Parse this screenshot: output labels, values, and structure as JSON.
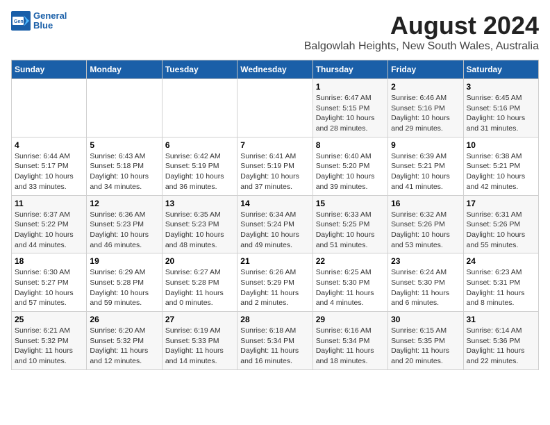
{
  "header": {
    "logo_line1": "General",
    "logo_line2": "Blue",
    "main_title": "August 2024",
    "subtitle": "Balgowlah Heights, New South Wales, Australia"
  },
  "weekdays": [
    "Sunday",
    "Monday",
    "Tuesday",
    "Wednesday",
    "Thursday",
    "Friday",
    "Saturday"
  ],
  "weeks": [
    [
      {
        "day": "",
        "info": ""
      },
      {
        "day": "",
        "info": ""
      },
      {
        "day": "",
        "info": ""
      },
      {
        "day": "",
        "info": ""
      },
      {
        "day": "1",
        "info": "Sunrise: 6:47 AM\nSunset: 5:15 PM\nDaylight: 10 hours\nand 28 minutes."
      },
      {
        "day": "2",
        "info": "Sunrise: 6:46 AM\nSunset: 5:16 PM\nDaylight: 10 hours\nand 29 minutes."
      },
      {
        "day": "3",
        "info": "Sunrise: 6:45 AM\nSunset: 5:16 PM\nDaylight: 10 hours\nand 31 minutes."
      }
    ],
    [
      {
        "day": "4",
        "info": "Sunrise: 6:44 AM\nSunset: 5:17 PM\nDaylight: 10 hours\nand 33 minutes."
      },
      {
        "day": "5",
        "info": "Sunrise: 6:43 AM\nSunset: 5:18 PM\nDaylight: 10 hours\nand 34 minutes."
      },
      {
        "day": "6",
        "info": "Sunrise: 6:42 AM\nSunset: 5:19 PM\nDaylight: 10 hours\nand 36 minutes."
      },
      {
        "day": "7",
        "info": "Sunrise: 6:41 AM\nSunset: 5:19 PM\nDaylight: 10 hours\nand 37 minutes."
      },
      {
        "day": "8",
        "info": "Sunrise: 6:40 AM\nSunset: 5:20 PM\nDaylight: 10 hours\nand 39 minutes."
      },
      {
        "day": "9",
        "info": "Sunrise: 6:39 AM\nSunset: 5:21 PM\nDaylight: 10 hours\nand 41 minutes."
      },
      {
        "day": "10",
        "info": "Sunrise: 6:38 AM\nSunset: 5:21 PM\nDaylight: 10 hours\nand 42 minutes."
      }
    ],
    [
      {
        "day": "11",
        "info": "Sunrise: 6:37 AM\nSunset: 5:22 PM\nDaylight: 10 hours\nand 44 minutes."
      },
      {
        "day": "12",
        "info": "Sunrise: 6:36 AM\nSunset: 5:23 PM\nDaylight: 10 hours\nand 46 minutes."
      },
      {
        "day": "13",
        "info": "Sunrise: 6:35 AM\nSunset: 5:23 PM\nDaylight: 10 hours\nand 48 minutes."
      },
      {
        "day": "14",
        "info": "Sunrise: 6:34 AM\nSunset: 5:24 PM\nDaylight: 10 hours\nand 49 minutes."
      },
      {
        "day": "15",
        "info": "Sunrise: 6:33 AM\nSunset: 5:25 PM\nDaylight: 10 hours\nand 51 minutes."
      },
      {
        "day": "16",
        "info": "Sunrise: 6:32 AM\nSunset: 5:26 PM\nDaylight: 10 hours\nand 53 minutes."
      },
      {
        "day": "17",
        "info": "Sunrise: 6:31 AM\nSunset: 5:26 PM\nDaylight: 10 hours\nand 55 minutes."
      }
    ],
    [
      {
        "day": "18",
        "info": "Sunrise: 6:30 AM\nSunset: 5:27 PM\nDaylight: 10 hours\nand 57 minutes."
      },
      {
        "day": "19",
        "info": "Sunrise: 6:29 AM\nSunset: 5:28 PM\nDaylight: 10 hours\nand 59 minutes."
      },
      {
        "day": "20",
        "info": "Sunrise: 6:27 AM\nSunset: 5:28 PM\nDaylight: 11 hours\nand 0 minutes."
      },
      {
        "day": "21",
        "info": "Sunrise: 6:26 AM\nSunset: 5:29 PM\nDaylight: 11 hours\nand 2 minutes."
      },
      {
        "day": "22",
        "info": "Sunrise: 6:25 AM\nSunset: 5:30 PM\nDaylight: 11 hours\nand 4 minutes."
      },
      {
        "day": "23",
        "info": "Sunrise: 6:24 AM\nSunset: 5:30 PM\nDaylight: 11 hours\nand 6 minutes."
      },
      {
        "day": "24",
        "info": "Sunrise: 6:23 AM\nSunset: 5:31 PM\nDaylight: 11 hours\nand 8 minutes."
      }
    ],
    [
      {
        "day": "25",
        "info": "Sunrise: 6:21 AM\nSunset: 5:32 PM\nDaylight: 11 hours\nand 10 minutes."
      },
      {
        "day": "26",
        "info": "Sunrise: 6:20 AM\nSunset: 5:32 PM\nDaylight: 11 hours\nand 12 minutes."
      },
      {
        "day": "27",
        "info": "Sunrise: 6:19 AM\nSunset: 5:33 PM\nDaylight: 11 hours\nand 14 minutes."
      },
      {
        "day": "28",
        "info": "Sunrise: 6:18 AM\nSunset: 5:34 PM\nDaylight: 11 hours\nand 16 minutes."
      },
      {
        "day": "29",
        "info": "Sunrise: 6:16 AM\nSunset: 5:34 PM\nDaylight: 11 hours\nand 18 minutes."
      },
      {
        "day": "30",
        "info": "Sunrise: 6:15 AM\nSunset: 5:35 PM\nDaylight: 11 hours\nand 20 minutes."
      },
      {
        "day": "31",
        "info": "Sunrise: 6:14 AM\nSunset: 5:36 PM\nDaylight: 11 hours\nand 22 minutes."
      }
    ]
  ]
}
